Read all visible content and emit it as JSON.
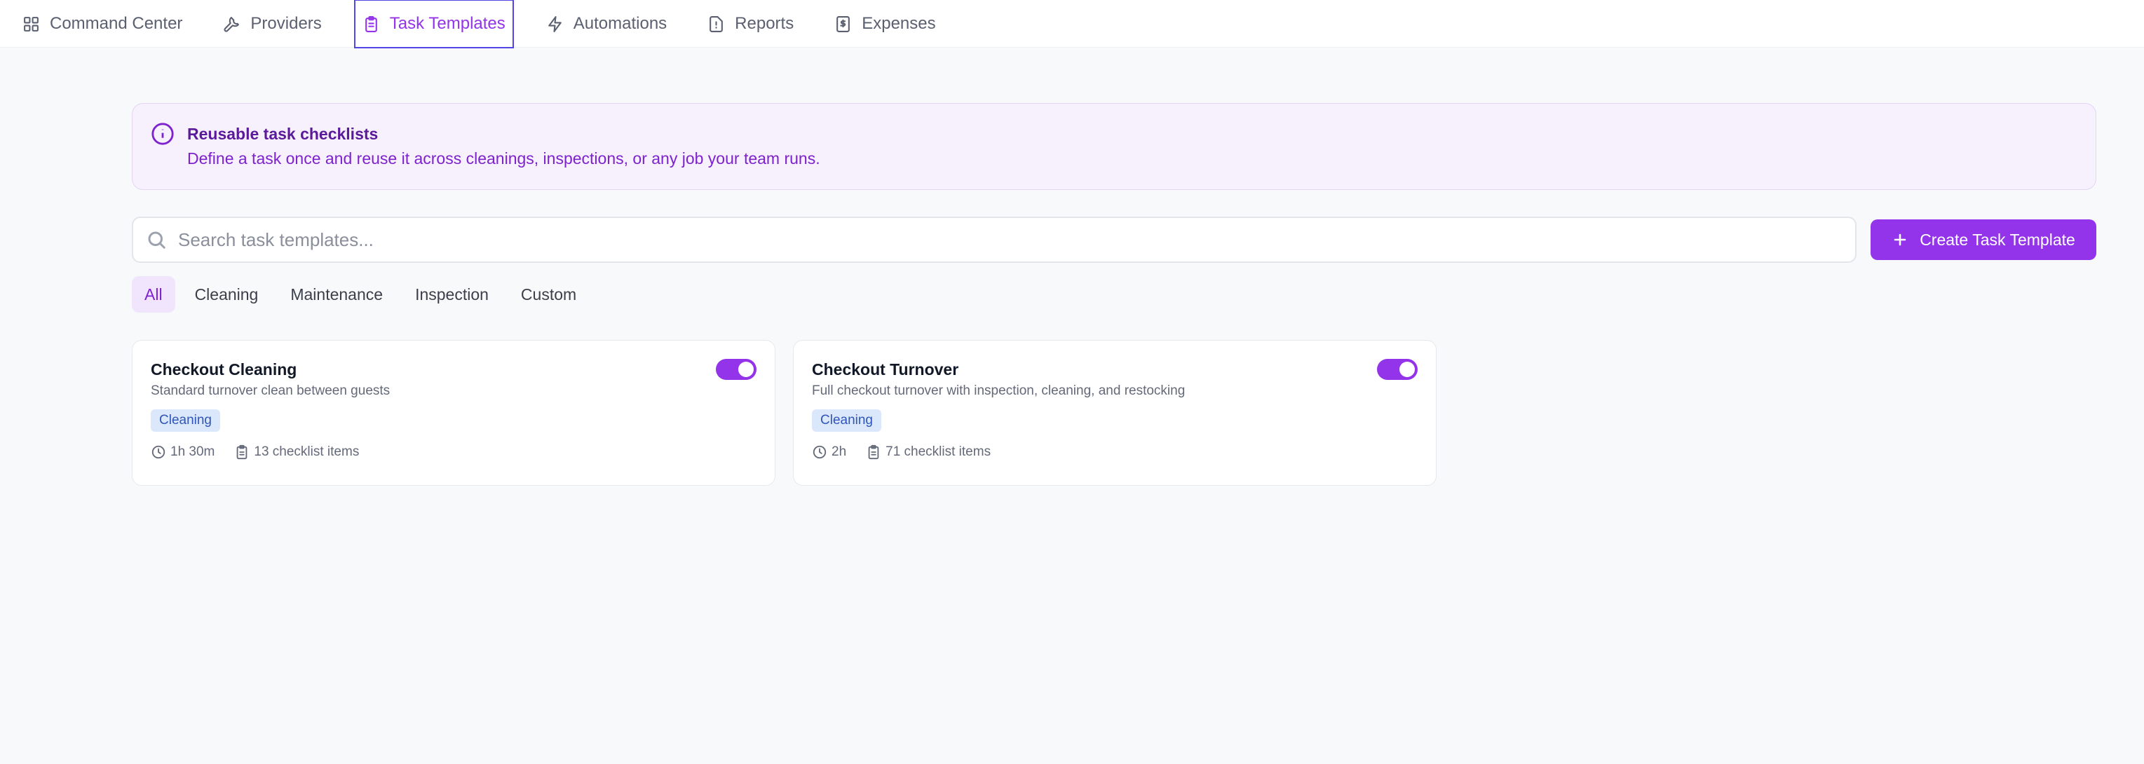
{
  "nav": {
    "tabs": [
      {
        "label": "Command Center",
        "icon": "grid-icon"
      },
      {
        "label": "Providers",
        "icon": "wrench-icon"
      },
      {
        "label": "Task Templates",
        "icon": "clipboard-icon",
        "active": true
      },
      {
        "label": "Automations",
        "icon": "lightning-icon"
      },
      {
        "label": "Reports",
        "icon": "report-icon"
      },
      {
        "label": "Expenses",
        "icon": "receipt-icon"
      }
    ]
  },
  "banner": {
    "title": "Reusable task checklists",
    "text": "Define a task once and reuse it across cleanings, inspections, or any job your team runs."
  },
  "search": {
    "placeholder": "Search task templates...",
    "value": ""
  },
  "create_button": {
    "label": "Create Task Template"
  },
  "filters": [
    {
      "label": "All",
      "active": true
    },
    {
      "label": "Cleaning"
    },
    {
      "label": "Maintenance"
    },
    {
      "label": "Inspection"
    },
    {
      "label": "Custom"
    }
  ],
  "templates": [
    {
      "title": "Checkout Cleaning",
      "description": "Standard turnover clean between guests",
      "category": "Cleaning",
      "duration": "1h 30m",
      "checklist": "13 checklist items",
      "enabled": true
    },
    {
      "title": "Checkout Turnover",
      "description": "Full checkout turnover with inspection, cleaning, and restocking",
      "category": "Cleaning",
      "duration": "2h",
      "checklist": "71 checklist items",
      "enabled": true
    }
  ],
  "colors": {
    "accent": "#9333ea",
    "badge_bg": "#dbe7fb",
    "badge_text": "#2f56b8"
  }
}
